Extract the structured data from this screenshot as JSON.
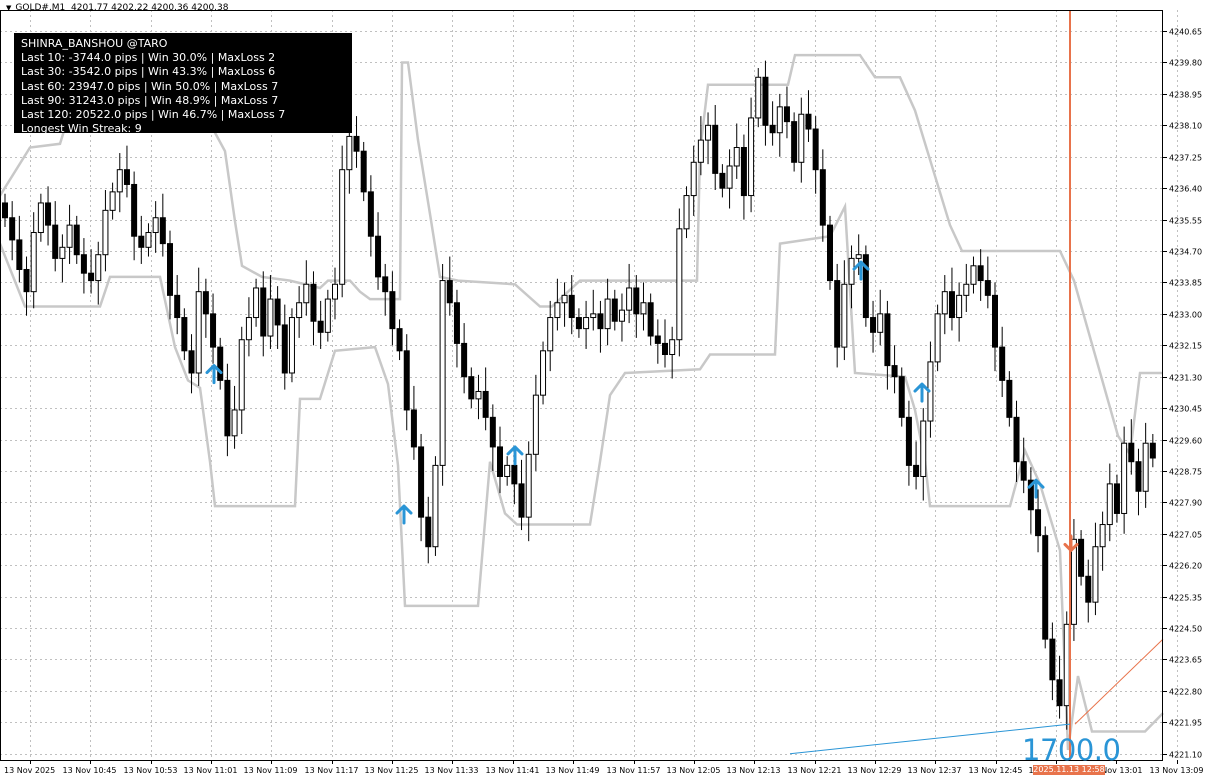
{
  "header": {
    "symbol": "GOLD#,M1",
    "ohlc": "4201.77 4202.22 4200.36 4200.38"
  },
  "stats_panel": {
    "lines": [
      "SHINRA_BANSHOU @TARO",
      "Last 10: -3744.0 pips | Win 30.0% | MaxLoss 2",
      "Last 30: -3542.0 pips | Win 43.3% | MaxLoss 6",
      "Last 60: 23947.0 pips | Win 50.0% | MaxLoss 7",
      "Last 90: 31243.0 pips | Win 48.9% | MaxLoss 7",
      "Last 120: 20522.0 pips | Win 46.7% | MaxLoss 7",
      "Longest Win Streak: 9"
    ]
  },
  "price_label": "1700.0",
  "trade_time_label": "2025.11.13 12:58",
  "colors": {
    "background": "#ffffff",
    "grid": "#c0c0c0",
    "candle": "#000000",
    "channel": "#c8c8c8",
    "buy_arrow": "#2a95d6",
    "sell_arrow": "#e8734b",
    "vline": "#e8734b",
    "trend_blue": "#2a95d6",
    "trend_orange": "#e8734b"
  },
  "chart_data": {
    "type": "candlestick",
    "ylim": [
      4220.93,
      4241.22
    ],
    "y_ticks": [
      4240.65,
      4239.8,
      4238.95,
      4238.1,
      4237.25,
      4236.4,
      4235.55,
      4234.7,
      4233.85,
      4233.0,
      4232.15,
      4231.3,
      4230.45,
      4229.6,
      4228.75,
      4227.9,
      4227.05,
      4226.2,
      4225.35,
      4224.5,
      4223.65,
      4222.8,
      4221.95,
      4221.1
    ],
    "x_ticks": [
      "13 Nov 2025",
      "13 Nov 10:45",
      "13 Nov 10:53",
      "13 Nov 11:01",
      "13 Nov 11:09",
      "13 Nov 11:17",
      "13 Nov 11:25",
      "13 Nov 11:33",
      "13 Nov 11:41",
      "13 Nov 11:49",
      "13 Nov 11:57",
      "13 Nov 12:05",
      "13 Nov 12:13",
      "13 Nov 12:21",
      "13 Nov 12:29",
      "13 Nov 12:37",
      "13 Nov 12:45",
      "13 Nov 12:53",
      "13 Nov 13:01",
      "13 Nov 13:09"
    ],
    "closes": [
      4235.6,
      4235.0,
      4234.2,
      4233.6,
      4235.2,
      4236.0,
      4235.4,
      4234.5,
      4234.8,
      4235.4,
      4234.6,
      4234.1,
      4233.9,
      4234.6,
      4235.8,
      4236.3,
      4236.9,
      4236.5,
      4235.1,
      4234.8,
      4235.2,
      4235.6,
      4234.9,
      4233.5,
      4232.9,
      4232.0,
      4231.4,
      4233.6,
      4233.0,
      4232.1,
      4231.2,
      4229.7,
      4230.4,
      4232.3,
      4232.9,
      4233.7,
      4232.4,
      4233.4,
      4232.7,
      4231.4,
      4232.9,
      4233.3,
      4233.8,
      4232.8,
      4232.5,
      4233.4,
      4233.8,
      4236.9,
      4237.8,
      4237.4,
      4236.3,
      4235.1,
      4234.0,
      4233.6,
      4232.6,
      4232.0,
      4230.4,
      4229.4,
      4227.5,
      4226.7,
      4228.9,
      4233.9,
      4233.3,
      4232.2,
      4231.3,
      4230.7,
      4230.9,
      4230.2,
      4229.4,
      4228.6,
      4228.9,
      4228.4,
      4227.5,
      4229.2,
      4230.8,
      4232.0,
      4232.9,
      4233.3,
      4233.5,
      4232.9,
      4232.6,
      4232.9,
      4233.0,
      4232.6,
      4233.4,
      4232.8,
      4233.1,
      4233.7,
      4233.0,
      4233.3,
      4232.4,
      4232.2,
      4231.9,
      4232.3,
      4235.3,
      4236.2,
      4237.1,
      4237.7,
      4238.1,
      4236.8,
      4236.4,
      4237.0,
      4237.5,
      4236.2,
      4238.3,
      4239.4,
      4238.1,
      4237.9,
      4238.6,
      4238.2,
      4237.1,
      4238.4,
      4238.0,
      4236.9,
      4235.4,
      4233.9,
      4232.1,
      4233.8,
      4234.5,
      4234.6,
      4232.9,
      4232.5,
      4233.0,
      4231.6,
      4231.3,
      4230.2,
      4228.9,
      4228.6,
      4230.1,
      4231.7,
      4233.0,
      4233.6,
      4232.9,
      4233.5,
      4233.8,
      4234.3,
      4233.9,
      4233.5,
      4232.1,
      4231.2,
      4230.2,
      4229.0,
      4228.5,
      4227.7,
      4227.0,
      4224.2,
      4223.1,
      4222.4,
      4224.6,
      4226.9,
      4225.9,
      4225.2,
      4226.7,
      4227.3,
      4228.4,
      4227.6,
      4229.5,
      4229.0,
      4228.2,
      4229.5,
      4229.1
    ],
    "upper_channel": [
      [
        0,
        4236.2
      ],
      [
        30,
        4237.5
      ],
      [
        60,
        4237.6
      ],
      [
        68,
        4238.3
      ],
      [
        85,
        4238.6
      ],
      [
        105,
        4238.3
      ],
      [
        140,
        4239.6
      ],
      [
        158,
        4239.8
      ],
      [
        195,
        4238.9
      ],
      [
        225,
        4237.4
      ],
      [
        235,
        4235.5
      ],
      [
        242,
        4234.3
      ],
      [
        262,
        4234.0
      ],
      [
        290,
        4233.9
      ],
      [
        320,
        4233.7
      ],
      [
        328,
        4233.9
      ],
      [
        350,
        4233.9
      ],
      [
        360,
        4233.6
      ],
      [
        370,
        4233.4
      ],
      [
        400,
        4233.4
      ],
      [
        402,
        4239.8
      ],
      [
        408,
        4239.8
      ],
      [
        418,
        4237.7
      ],
      [
        430,
        4235.7
      ],
      [
        440,
        4234.0
      ],
      [
        458,
        4233.9
      ],
      [
        515,
        4233.8
      ],
      [
        540,
        4233.2
      ],
      [
        552,
        4233.2
      ],
      [
        580,
        4233.9
      ],
      [
        697,
        4233.9
      ],
      [
        700,
        4237.4
      ],
      [
        708,
        4239.2
      ],
      [
        788,
        4239.2
      ],
      [
        795,
        4240.0
      ],
      [
        860,
        4240.0
      ],
      [
        875,
        4239.4
      ],
      [
        900,
        4239.4
      ],
      [
        915,
        4238.5
      ],
      [
        950,
        4235.4
      ],
      [
        962,
        4234.7
      ],
      [
        1060,
        4234.7
      ],
      [
        1074,
        4233.9
      ],
      [
        1118,
        4229.7
      ],
      [
        1130,
        4229.2
      ],
      [
        1140,
        4231.4
      ],
      [
        1163,
        4231.4
      ]
    ],
    "lower_channel": [
      [
        0,
        4234.9
      ],
      [
        25,
        4233.2
      ],
      [
        100,
        4233.2
      ],
      [
        110,
        4234.0
      ],
      [
        160,
        4234.0
      ],
      [
        175,
        4232.1
      ],
      [
        188,
        4231.2
      ],
      [
        200,
        4231.0
      ],
      [
        210,
        4229.0
      ],
      [
        215,
        4227.8
      ],
      [
        295,
        4227.8
      ],
      [
        300,
        4230.7
      ],
      [
        320,
        4230.7
      ],
      [
        335,
        4232.0
      ],
      [
        375,
        4232.1
      ],
      [
        388,
        4231.1
      ],
      [
        398,
        4228.9
      ],
      [
        405,
        4225.1
      ],
      [
        478,
        4225.1
      ],
      [
        490,
        4229.0
      ],
      [
        505,
        4227.6
      ],
      [
        517,
        4227.3
      ],
      [
        590,
        4227.3
      ],
      [
        600,
        4229.0
      ],
      [
        610,
        4230.8
      ],
      [
        625,
        4231.4
      ],
      [
        700,
        4231.5
      ],
      [
        710,
        4231.9
      ],
      [
        775,
        4231.9
      ],
      [
        780,
        4234.9
      ],
      [
        830,
        4235.1
      ],
      [
        845,
        4235.9
      ],
      [
        855,
        4231.4
      ],
      [
        905,
        4231.3
      ],
      [
        915,
        4230.4
      ],
      [
        925,
        4229.0
      ],
      [
        930,
        4227.8
      ],
      [
        1010,
        4227.8
      ],
      [
        1025,
        4229.3
      ],
      [
        1040,
        4228.4
      ],
      [
        1060,
        4226.6
      ],
      [
        1068,
        4221.2
      ],
      [
        1078,
        4223.2
      ],
      [
        1092,
        4221.7
      ],
      [
        1145,
        4221.7
      ],
      [
        1163,
        4222.2
      ]
    ],
    "buy_arrows": [
      [
        214,
        4231.6
      ],
      [
        404,
        4227.8
      ],
      [
        515,
        4229.4
      ],
      [
        861,
        4234.4
      ],
      [
        922,
        4231.1
      ],
      [
        1036,
        4228.5
      ]
    ],
    "sell_arrows": [
      [
        1071,
        4226.6
      ]
    ],
    "vline_x": 1070,
    "trend_blue": [
      [
        790,
        4221.1
      ],
      [
        1070,
        4221.9
      ]
    ],
    "trend_orange": [
      [
        1075,
        4221.9
      ],
      [
        1163,
        4224.2
      ]
    ]
  }
}
